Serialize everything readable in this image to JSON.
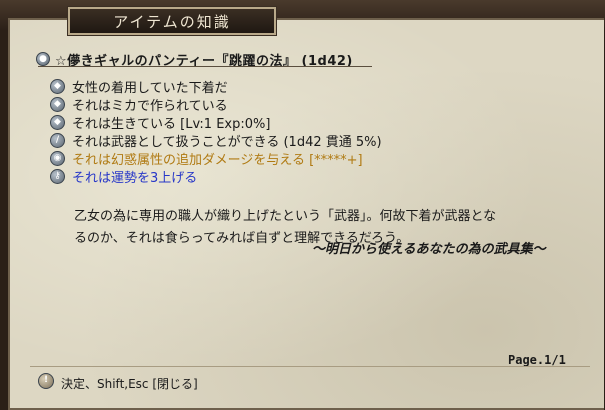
{
  "window": {
    "title": "アイテムの知識",
    "ghost_title": ""
  },
  "item": {
    "name": "☆儚きギャルのパンティー『跳躍の法』 (1d42)"
  },
  "properties": [
    {
      "text": "女性の着用していた下着だ",
      "icon": "diamond-icon",
      "color": "black"
    },
    {
      "text": "それはミカで作られている",
      "icon": "diamond-icon",
      "color": "black"
    },
    {
      "text": "それは生きている [Lv:1 Exp:0%]",
      "icon": "diamond-icon",
      "color": "black"
    },
    {
      "text": "それは武器として扱うことができる (1d42 貫通 5%)",
      "icon": "sword-icon",
      "color": "black"
    },
    {
      "text": "それは幻惑属性の追加ダメージを与える [*****+]",
      "icon": "eye-icon",
      "color": "orange"
    },
    {
      "text": "それは運勢を3上げる",
      "icon": "key-icon",
      "color": "blue"
    }
  ],
  "description": {
    "line1": "乙女の為に専用の職人が織り上げたという「武器」。何故下着が武器とな",
    "line2": "るのか、それは食らってみれば自ずと理解できるだろう。",
    "quote": "～明日から使えるあなたの為の武具集～"
  },
  "page_indicator": "Page.1/1",
  "footer": {
    "hint": "決定、Shift,Esc [閉じる]",
    "icon": "lightbulb-icon"
  },
  "colors": {
    "orange": "#b07a12",
    "blue": "#2636c8",
    "parchment": "#ddd7c3"
  }
}
